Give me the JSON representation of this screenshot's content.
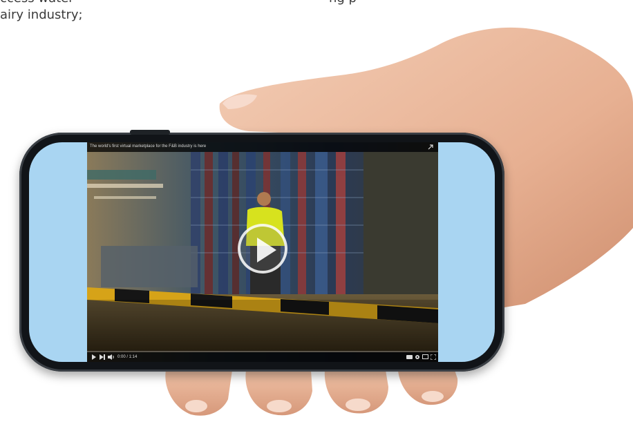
{
  "page": {
    "body_text": "ccess water\nairy industry;",
    "body_text_right": "ng p"
  },
  "video": {
    "title": "The world's first virtual marketplace for the F&B industry is here",
    "time": "0:00 / 1:14",
    "progress": 0,
    "play_label": "Play"
  },
  "colors": {
    "screen_bg": "#a9d5f2",
    "progress_red": "#e0241d",
    "phone_frame": "#111418"
  },
  "icons": {
    "play": "play-icon",
    "share": "share-icon",
    "volume": "volume-icon",
    "next": "next-icon",
    "settings": "gear-icon",
    "cast": "cast-icon",
    "fullscreen": "fullscreen-icon"
  }
}
